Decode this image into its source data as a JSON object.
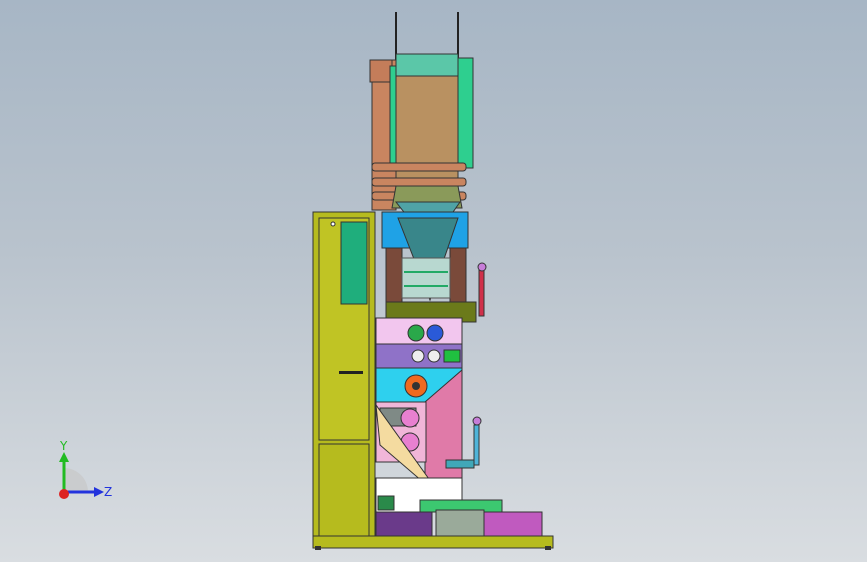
{
  "viewport": {
    "background_top": "#a7b6c5",
    "background_bottom": "#d9dde1"
  },
  "triad": {
    "y_label": "Y",
    "z_label": "Z",
    "y_color": "#22bb22",
    "z_color": "#2233dd",
    "x_color": "#dd2222"
  }
}
